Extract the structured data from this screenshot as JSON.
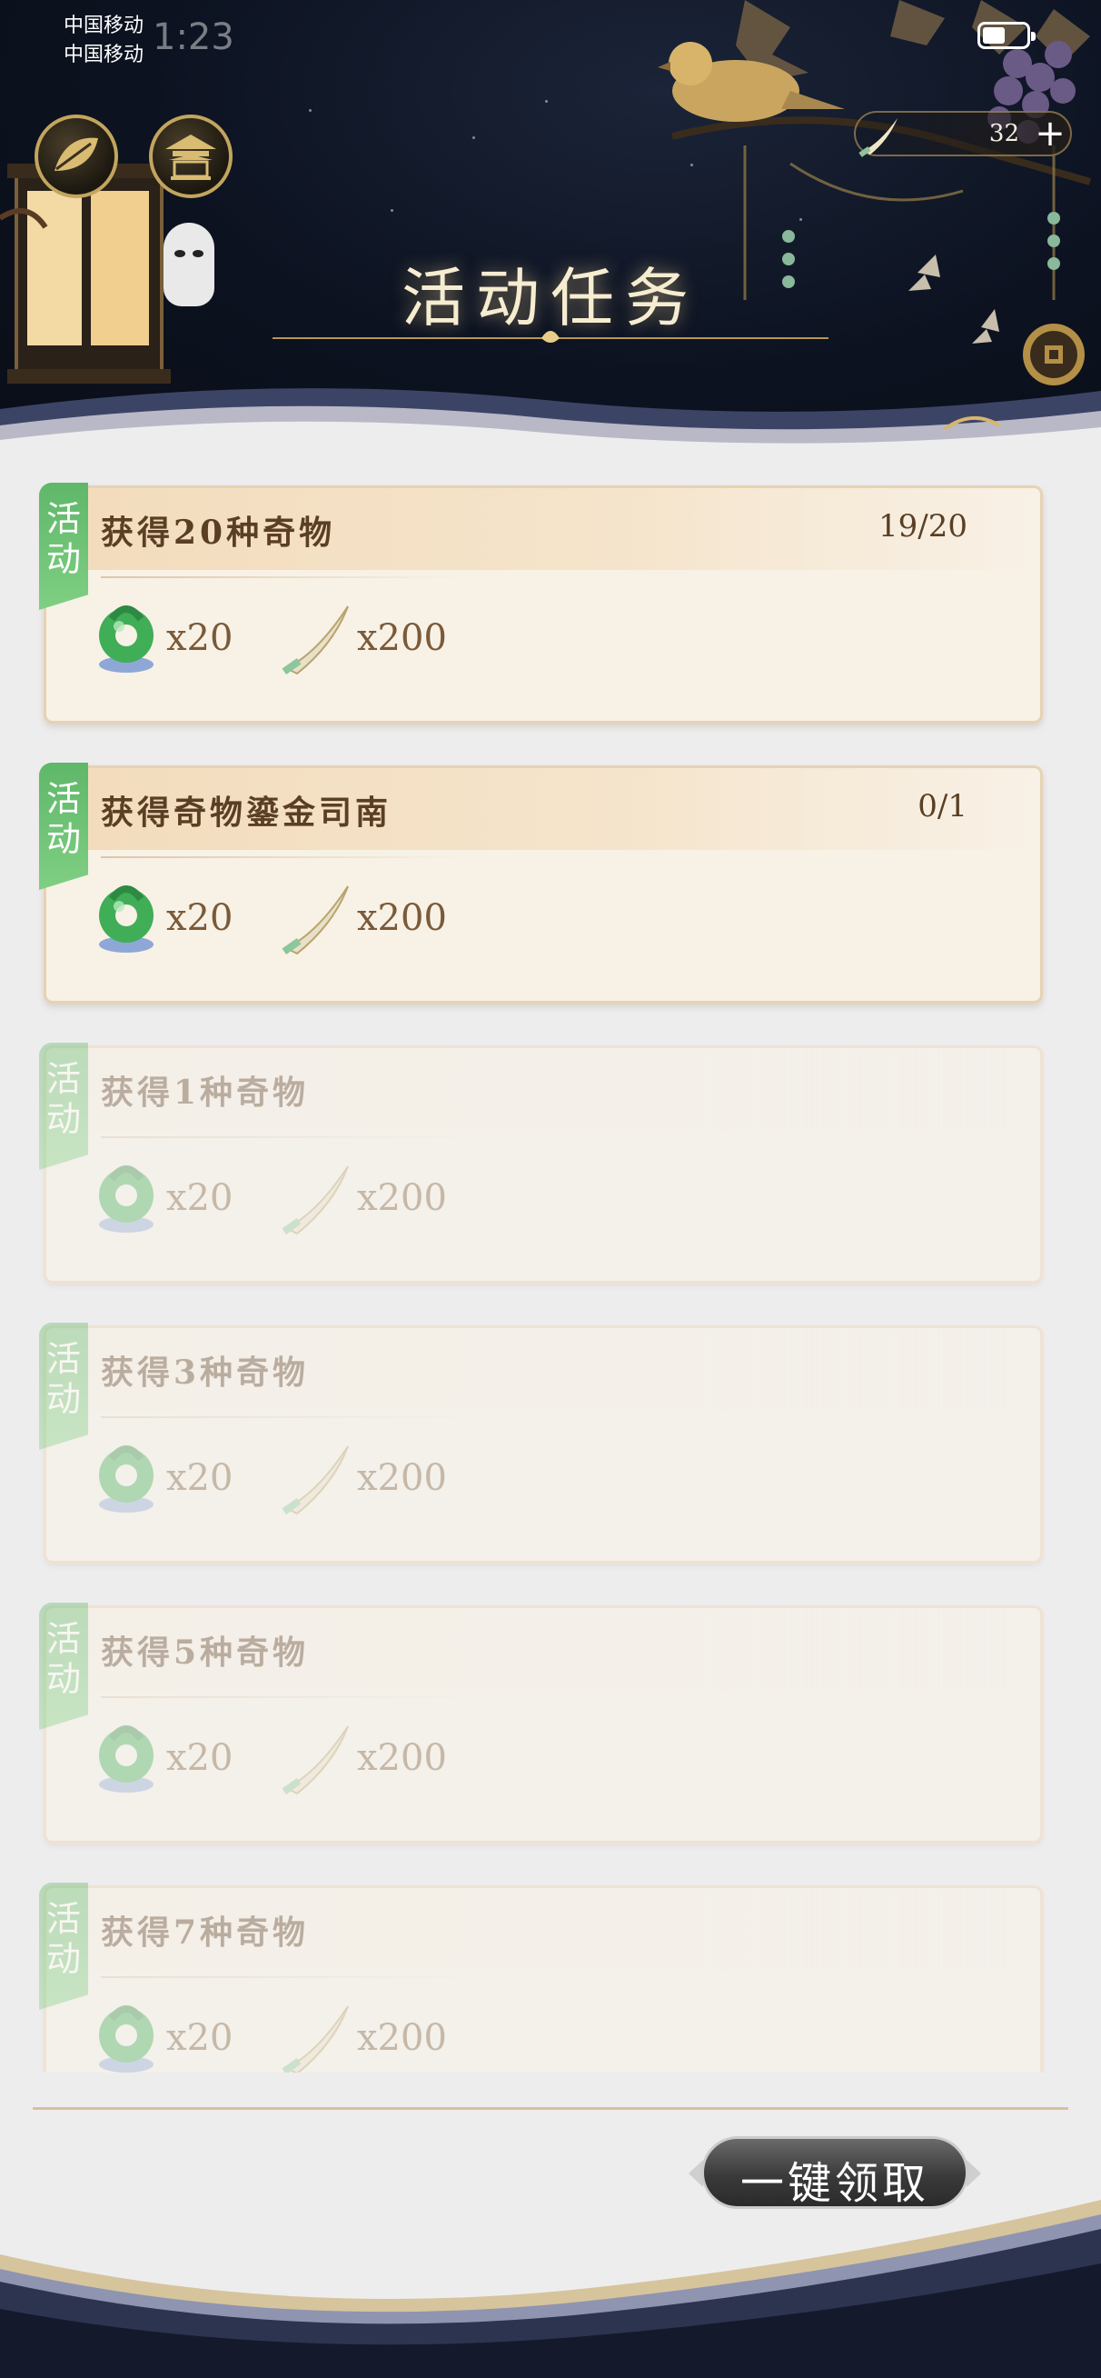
{
  "status_bar": {
    "carrier_1": "中国移动",
    "carrier_2": "中国移动",
    "time": "1:23"
  },
  "header": {
    "title": "活动任务",
    "currency": {
      "icon": "dagger-icon",
      "value": "32",
      "add_icon": "plus-icon"
    },
    "left_buttons": [
      "leaf-icon",
      "pavilion-icon"
    ]
  },
  "tasks": [
    {
      "tag": "活动",
      "title": "获得20种奇物",
      "progress": "19/20",
      "state": "active",
      "rewards": [
        {
          "icon": "jade-pendant-icon",
          "qty": "x20"
        },
        {
          "icon": "dagger-icon",
          "qty": "x200"
        }
      ]
    },
    {
      "tag": "活动",
      "title": "获得奇物鎏金司南",
      "progress": "0/1",
      "state": "active",
      "rewards": [
        {
          "icon": "jade-pendant-icon",
          "qty": "x20"
        },
        {
          "icon": "dagger-icon",
          "qty": "x200"
        }
      ]
    },
    {
      "tag": "活动",
      "title": "获得1种奇物",
      "progress": "",
      "state": "completed",
      "rewards": [
        {
          "icon": "jade-pendant-icon",
          "qty": "x20"
        },
        {
          "icon": "dagger-icon",
          "qty": "x200"
        }
      ]
    },
    {
      "tag": "活动",
      "title": "获得3种奇物",
      "progress": "",
      "state": "completed",
      "rewards": [
        {
          "icon": "jade-pendant-icon",
          "qty": "x20"
        },
        {
          "icon": "dagger-icon",
          "qty": "x200"
        }
      ]
    },
    {
      "tag": "活动",
      "title": "获得5种奇物",
      "progress": "",
      "state": "completed",
      "rewards": [
        {
          "icon": "jade-pendant-icon",
          "qty": "x20"
        },
        {
          "icon": "dagger-icon",
          "qty": "x200"
        }
      ]
    },
    {
      "tag": "活动",
      "title": "获得7种奇物",
      "progress": "",
      "state": "completed",
      "rewards": [
        {
          "icon": "jade-pendant-icon",
          "qty": "x20"
        },
        {
          "icon": "dagger-icon",
          "qty": "x200"
        }
      ]
    }
  ],
  "footer": {
    "claim_all_label": "一键领取"
  },
  "colors": {
    "tag_green": "#6cc070",
    "title_gold": "#f6ecd0",
    "text_brown": "#5a3f24",
    "header_navy": "#0c1220"
  }
}
